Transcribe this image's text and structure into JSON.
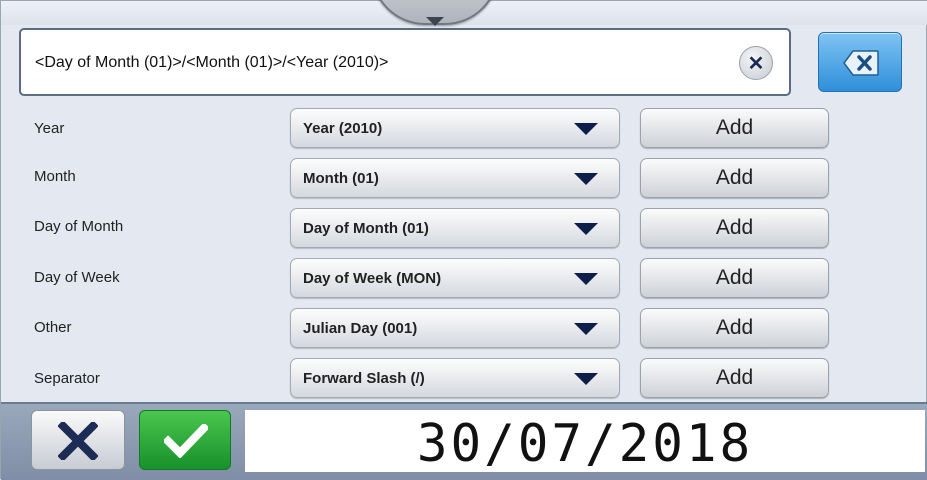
{
  "expression": {
    "text": "<Day of Month (01)>/<Month (01)>/<Year (2010)>",
    "clear_icon": "close-circle-icon",
    "backspace_icon": "backspace-icon"
  },
  "rows": [
    {
      "label": "Year",
      "selected": "Year (2010)",
      "add": "Add"
    },
    {
      "label": "Month",
      "selected": "Month (01)",
      "add": "Add"
    },
    {
      "label": "Day of Month",
      "selected": "Day of Month (01)",
      "add": "Add"
    },
    {
      "label": "Day of Week",
      "selected": "Day of Week (MON)",
      "add": "Add"
    },
    {
      "label": "Other",
      "selected": "Julian Day (001)",
      "add": "Add"
    },
    {
      "label": "Separator",
      "selected": "Forward Slash (/)",
      "add": "Add"
    }
  ],
  "footer": {
    "preview": "30/07/2018",
    "cancel_icon": "x-icon",
    "confirm_icon": "checkmark-icon"
  },
  "colors": {
    "accent_blue": "#2e8fd8",
    "confirm_green": "#17912a",
    "bar_gray": "#7f8ea6"
  }
}
